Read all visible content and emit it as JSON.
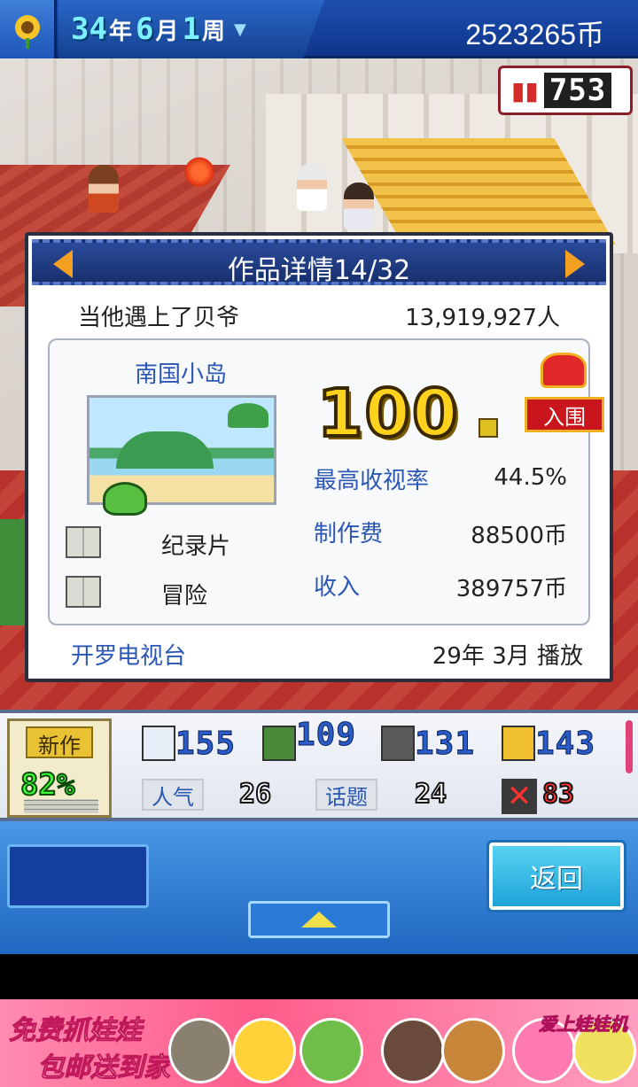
{
  "header": {
    "year": "34",
    "year_unit": "年",
    "month": "6",
    "month_unit": "月",
    "week": "1",
    "week_unit": "周",
    "money": "2523265币"
  },
  "rating_badge": {
    "value": "753"
  },
  "dialog": {
    "title": "作品详情14/32",
    "show_name": "当他遇上了贝爷",
    "viewers": "13,919,927人",
    "theme": "南国小岛",
    "genres": [
      "纪录片",
      "冒险"
    ],
    "score": "100",
    "award_label": "入围",
    "stats": [
      {
        "label": "最高收视率",
        "value": "44.5%"
      },
      {
        "label": "制作费",
        "value": "88500币"
      },
      {
        "label": "收入",
        "value": "389757币"
      }
    ],
    "station": "开罗电视台",
    "aired": "29年 3月 播放"
  },
  "strip": {
    "new_label": "新作",
    "new_pct": "82%",
    "stats": [
      "155",
      "109",
      "131",
      "143"
    ],
    "popularity_label": "人气",
    "popularity_value": "26",
    "topic_label": "话题",
    "topic_value": "24",
    "penalty_value": "83"
  },
  "controls": {
    "back_label": "返回"
  },
  "ad": {
    "line1": "免费抓娃娃",
    "line2": "包邮送到家",
    "brand": "爱上娃娃机"
  },
  "colors": {
    "accent_blue": "#2a57b3",
    "header_blue": "#18306e",
    "score_gold": "#ffd21e",
    "back_button": "#1ea3d8"
  },
  "icons": {
    "logo": "sunflower-icon",
    "rating": "rating-chart-icon",
    "prev": "arrow-left-icon",
    "next": "arrow-right-icon",
    "genre": "open-book-icon",
    "award": "crown-icon",
    "strip": [
      "script-icon",
      "actors-icon",
      "camera-icon",
      "music-note-icon",
      "cross-icon"
    ]
  }
}
